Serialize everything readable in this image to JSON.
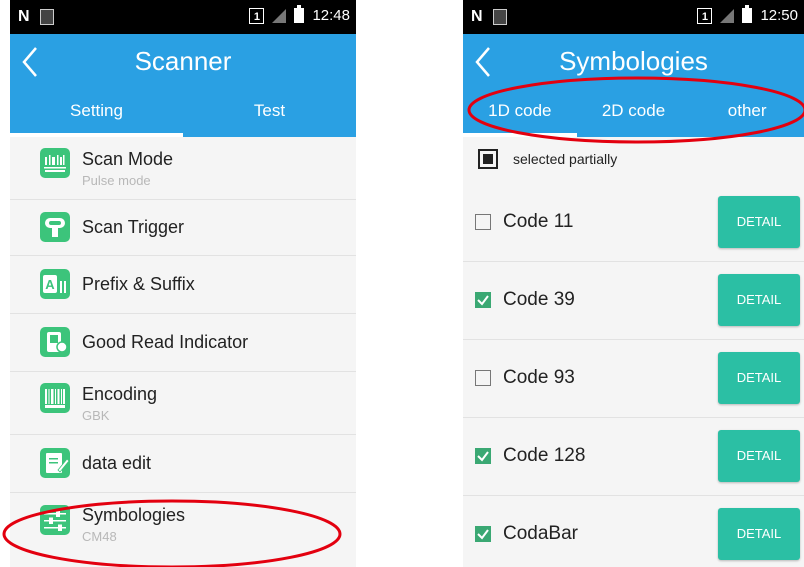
{
  "left": {
    "status": {
      "sim": "1",
      "time": "12:48"
    },
    "title": "Scanner",
    "tabs": [
      {
        "label": "Setting"
      },
      {
        "label": "Test"
      }
    ],
    "items": [
      {
        "icon": "scan-mode-icon",
        "title": "Scan Mode",
        "subtitle": "Pulse mode"
      },
      {
        "icon": "scan-trigger-icon",
        "title": "Scan Trigger",
        "subtitle": ""
      },
      {
        "icon": "prefix-suffix-icon",
        "title": "Prefix & Suffix",
        "subtitle": ""
      },
      {
        "icon": "good-read-indicator-icon",
        "title": "Good Read Indicator",
        "subtitle": ""
      },
      {
        "icon": "encoding-barcode-icon",
        "title": "Encoding",
        "subtitle": "GBK"
      },
      {
        "icon": "data-edit-icon",
        "title": "data edit",
        "subtitle": ""
      },
      {
        "icon": "symbologies-sliders-icon",
        "title": "Symbologies",
        "subtitle": "CM48"
      }
    ]
  },
  "right": {
    "status": {
      "sim": "1",
      "time": "12:50"
    },
    "title": "Symbologies",
    "tabs": [
      {
        "label": "1D code"
      },
      {
        "label": "2D code"
      },
      {
        "label": "other"
      }
    ],
    "selected_label": "selected partially",
    "codes": [
      {
        "name": "Code 11",
        "checked": false,
        "button": "DETAIL"
      },
      {
        "name": "Code 39",
        "checked": true,
        "button": "DETAIL"
      },
      {
        "name": "Code 93",
        "checked": false,
        "button": "DETAIL"
      },
      {
        "name": "Code 128",
        "checked": true,
        "button": "DETAIL"
      },
      {
        "name": "CodaBar",
        "checked": true,
        "button": "DETAIL"
      }
    ]
  },
  "colors": {
    "appbar": "#2aa0e3",
    "icon_green": "#3cc47b",
    "detail_button": "#2bbfa4",
    "annotation_red": "#e3000f",
    "checkbox_green": "#3aa873"
  }
}
